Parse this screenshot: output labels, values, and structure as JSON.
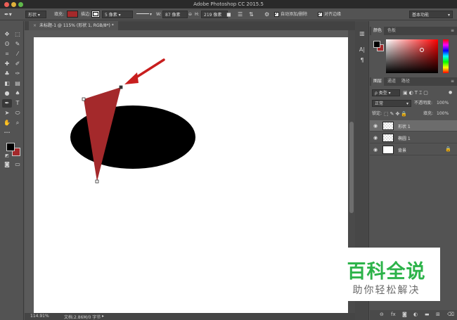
{
  "window": {
    "title": "Adobe Photoshop CC 2015.5"
  },
  "options_bar": {
    "tool_mode": "形状",
    "fill_label": "填充:",
    "fill_color": "#a4292b",
    "stroke_label": "描边:",
    "stroke_width": "5 像素",
    "width_label": "W:",
    "width_value": "87 像素",
    "link_icon": "⊖",
    "height_label": "H:",
    "height_value": "219 像素",
    "auto_add_delete": "自动添加/删除",
    "align_edges": "对齐边缘",
    "workspace": "基本功能"
  },
  "document": {
    "tab_title": "未标题-1 @ 115% (形状 1, RGB/8*) *",
    "close_icon": "×",
    "shape_color": "#a4292b",
    "ellipse_color": "#000000",
    "arrow_color": "#c81e1e"
  },
  "status": {
    "zoom": "114.91%",
    "doc_info": "文档:2.86M/0 字节"
  },
  "tools": {
    "foreground": "#000000",
    "background": "#a4292b",
    "items": [
      {
        "name": "move-tool-icon",
        "glyph": "✥"
      },
      {
        "name": "marquee-tool-icon",
        "glyph": "⬚"
      },
      {
        "name": "lasso-tool-icon",
        "glyph": "ʘ"
      },
      {
        "name": "quick-select-tool-icon",
        "glyph": "✎"
      },
      {
        "name": "crop-tool-icon",
        "glyph": "⌗"
      },
      {
        "name": "eyedropper-tool-icon",
        "glyph": "⁄"
      },
      {
        "name": "healing-tool-icon",
        "glyph": "✚"
      },
      {
        "name": "brush-tool-icon",
        "glyph": "✐"
      },
      {
        "name": "stamp-tool-icon",
        "glyph": "♣"
      },
      {
        "name": "history-brush-tool-icon",
        "glyph": "✑"
      },
      {
        "name": "eraser-tool-icon",
        "glyph": "◧"
      },
      {
        "name": "gradient-tool-icon",
        "glyph": "▤"
      },
      {
        "name": "blur-tool-icon",
        "glyph": "●"
      },
      {
        "name": "dodge-tool-icon",
        "glyph": "♠"
      },
      {
        "name": "pen-tool-icon",
        "glyph": "✒"
      },
      {
        "name": "type-tool-icon",
        "glyph": "T"
      },
      {
        "name": "path-select-tool-icon",
        "glyph": "➤"
      },
      {
        "name": "shape-tool-icon",
        "glyph": "⬭"
      },
      {
        "name": "hand-tool-icon",
        "glyph": "✋"
      },
      {
        "name": "zoom-tool-icon",
        "glyph": "⌕"
      },
      {
        "name": "more-tools-icon",
        "glyph": "•••"
      }
    ]
  },
  "color_panel": {
    "tabs": [
      "颜色",
      "色板"
    ],
    "foreground": "#000000",
    "background": "#a4292b",
    "hue_base": "#ff0000"
  },
  "layers_panel": {
    "tabs": [
      "图层",
      "通道",
      "路径"
    ],
    "filter_label": "ρ 类型",
    "blend_mode": "正常",
    "opacity_label": "不透明度:",
    "opacity_value": "100%",
    "lock_label": "锁定:",
    "fill_label": "填充:",
    "fill_value": "100%",
    "layers": [
      {
        "name": "形状 1",
        "selected": true,
        "locked": false
      },
      {
        "name": "椭圆 1",
        "selected": false,
        "locked": false
      },
      {
        "name": "背景",
        "selected": false,
        "locked": true
      }
    ]
  },
  "watermark": {
    "main": "百科全说",
    "sub": "助你轻松解决"
  }
}
